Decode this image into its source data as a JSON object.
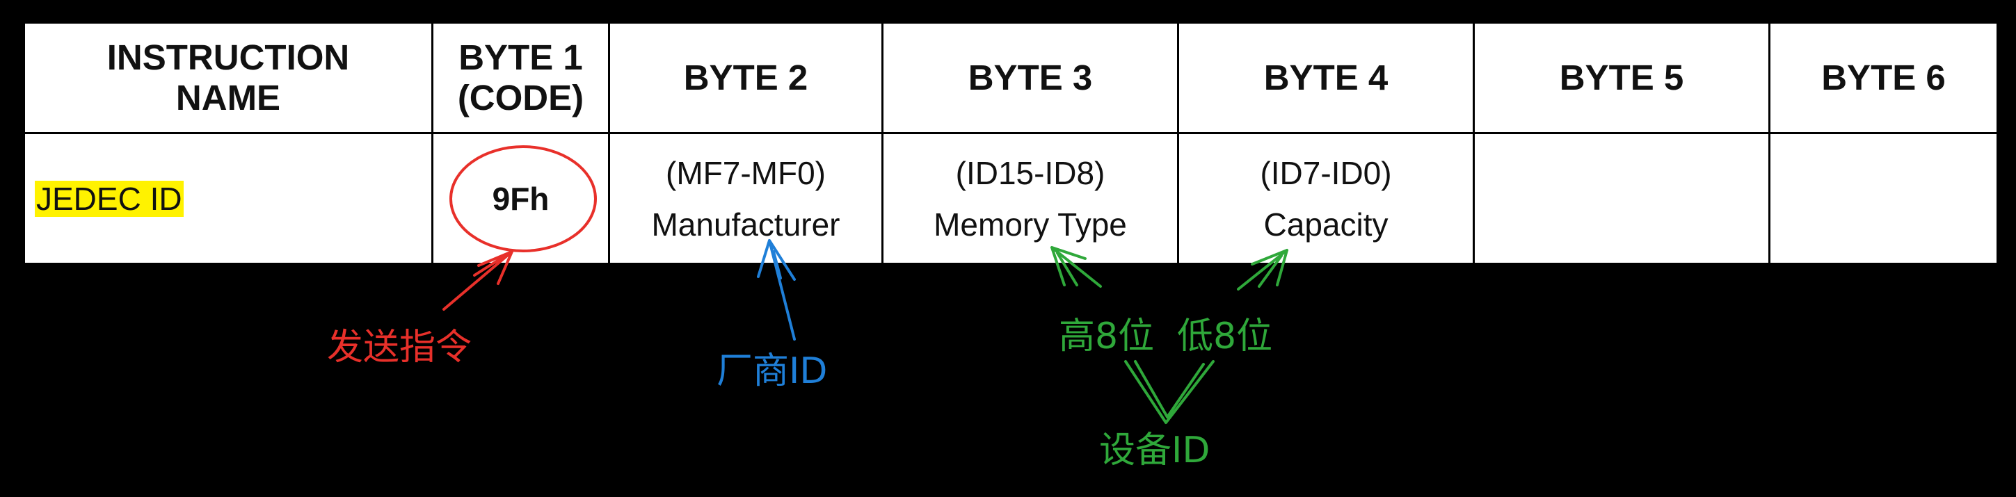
{
  "table": {
    "headers": [
      {
        "line1": "INSTRUCTION",
        "line2": "NAME"
      },
      {
        "line1": "BYTE 1",
        "line2": "(CODE)"
      },
      {
        "line1": "BYTE 2",
        "line2": ""
      },
      {
        "line1": "BYTE 3",
        "line2": ""
      },
      {
        "line1": "BYTE 4",
        "line2": ""
      },
      {
        "line1": "BYTE 5",
        "line2": ""
      },
      {
        "line1": "BYTE 6",
        "line2": ""
      }
    ],
    "row": {
      "name": "JEDEC ID",
      "code": "9Fh",
      "byte2": {
        "bits": "(MF7-MF0)",
        "desc": "Manufacturer"
      },
      "byte3": {
        "bits": "(ID15-ID8)",
        "desc": "Memory Type"
      },
      "byte4": {
        "bits": "(ID7-ID0)",
        "desc": "Capacity"
      },
      "byte5": "",
      "byte6": ""
    }
  },
  "annotations": {
    "send_command": {
      "text": "发送指令",
      "color": "#e8302a"
    },
    "manufacturer_id": {
      "text": "厂商ID",
      "color": "#1f7fd8"
    },
    "high_8_bits": {
      "text": "高8位",
      "color": "#2fa83a"
    },
    "low_8_bits": {
      "text": "低8位",
      "color": "#2fa83a"
    },
    "device_id": {
      "text": "设备ID",
      "color": "#2fa83a"
    }
  },
  "colors": {
    "background": "#000000",
    "table": "#ffffff",
    "highlight": "#fff200"
  }
}
